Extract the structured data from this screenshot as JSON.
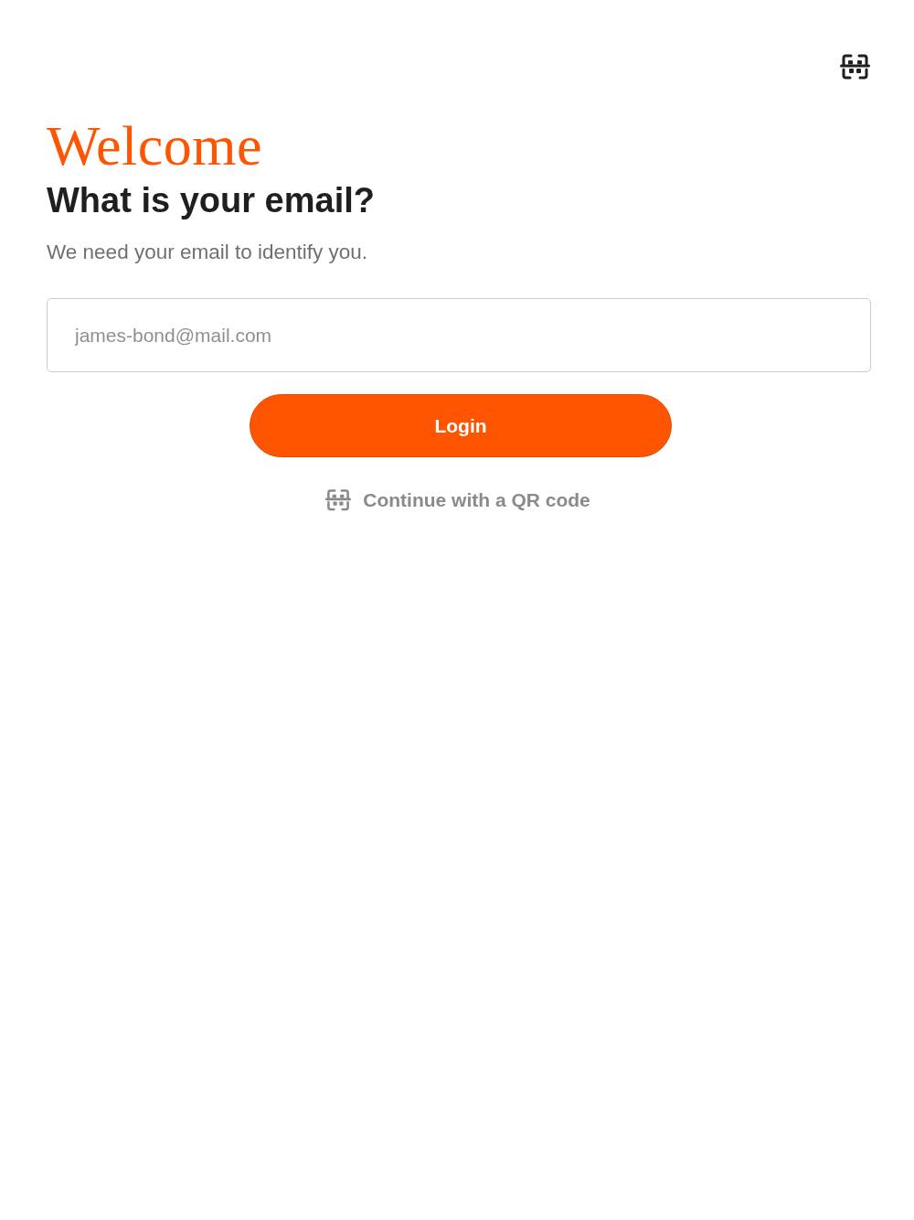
{
  "title": "Welcome",
  "heading": "What is your email?",
  "subtitle": "We need your email to identify you.",
  "email_field": {
    "placeholder": "james-bond@mail.com"
  },
  "login_button": {
    "label": "Login"
  },
  "qr_link": {
    "label": "Continue with a QR code"
  }
}
